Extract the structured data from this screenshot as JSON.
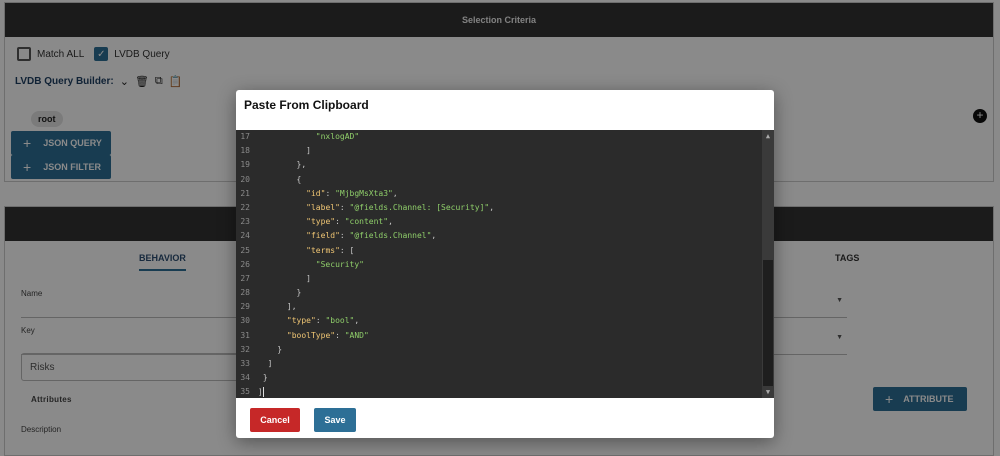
{
  "criteria": {
    "title": "Selection Criteria",
    "match_all_label": "Match ALL",
    "lvdb_query_label": "LVDB Query",
    "query_builder_label": "LVDB Query Builder:",
    "root_label": "root",
    "json_query_button": "JSON QUERY",
    "json_filter_button": "JSON FILTER"
  },
  "behavior": {
    "tabs": {
      "behavior": "BEHAVIOR",
      "tags": "TAGS"
    },
    "name_label": "Name",
    "key_label": "Key",
    "risks_placeholder": "Risks",
    "attributes_label": "Attributes",
    "attribute_button": "ATTRIBUTE",
    "description_label": "Description"
  },
  "modal": {
    "title": "Paste From Clipboard",
    "cancel_label": "Cancel",
    "save_label": "Save",
    "code_lines": [
      {
        "n": "17",
        "parts": [
          {
            "t": "            ",
            "c": ""
          },
          {
            "t": "\"nxlogAD\"",
            "c": "s"
          }
        ]
      },
      {
        "n": "18",
        "parts": [
          {
            "t": "          ]",
            "c": ""
          }
        ]
      },
      {
        "n": "19",
        "parts": [
          {
            "t": "        },",
            "c": ""
          }
        ]
      },
      {
        "n": "20",
        "parts": [
          {
            "t": "        {",
            "c": ""
          }
        ]
      },
      {
        "n": "21",
        "parts": [
          {
            "t": "          ",
            "c": ""
          },
          {
            "t": "\"id\"",
            "c": "k"
          },
          {
            "t": ": ",
            "c": ""
          },
          {
            "t": "\"MjbgMsXta3\"",
            "c": "s"
          },
          {
            "t": ",",
            "c": ""
          }
        ]
      },
      {
        "n": "22",
        "parts": [
          {
            "t": "          ",
            "c": ""
          },
          {
            "t": "\"label\"",
            "c": "k"
          },
          {
            "t": ": ",
            "c": ""
          },
          {
            "t": "\"@fields.Channel: [Security]\"",
            "c": "s"
          },
          {
            "t": ",",
            "c": ""
          }
        ]
      },
      {
        "n": "23",
        "parts": [
          {
            "t": "          ",
            "c": ""
          },
          {
            "t": "\"type\"",
            "c": "k"
          },
          {
            "t": ": ",
            "c": ""
          },
          {
            "t": "\"content\"",
            "c": "s"
          },
          {
            "t": ",",
            "c": ""
          }
        ]
      },
      {
        "n": "24",
        "parts": [
          {
            "t": "          ",
            "c": ""
          },
          {
            "t": "\"field\"",
            "c": "k"
          },
          {
            "t": ": ",
            "c": ""
          },
          {
            "t": "\"@fields.Channel\"",
            "c": "s"
          },
          {
            "t": ",",
            "c": ""
          }
        ]
      },
      {
        "n": "25",
        "parts": [
          {
            "t": "          ",
            "c": ""
          },
          {
            "t": "\"terms\"",
            "c": "k"
          },
          {
            "t": ": [",
            "c": ""
          }
        ]
      },
      {
        "n": "26",
        "parts": [
          {
            "t": "            ",
            "c": ""
          },
          {
            "t": "\"Security\"",
            "c": "s"
          }
        ]
      },
      {
        "n": "27",
        "parts": [
          {
            "t": "          ]",
            "c": ""
          }
        ]
      },
      {
        "n": "28",
        "parts": [
          {
            "t": "        }",
            "c": ""
          }
        ]
      },
      {
        "n": "29",
        "parts": [
          {
            "t": "      ],",
            "c": ""
          }
        ]
      },
      {
        "n": "30",
        "parts": [
          {
            "t": "      ",
            "c": ""
          },
          {
            "t": "\"type\"",
            "c": "k"
          },
          {
            "t": ": ",
            "c": ""
          },
          {
            "t": "\"bool\"",
            "c": "s"
          },
          {
            "t": ",",
            "c": ""
          }
        ]
      },
      {
        "n": "31",
        "parts": [
          {
            "t": "      ",
            "c": ""
          },
          {
            "t": "\"boolType\"",
            "c": "k"
          },
          {
            "t": ": ",
            "c": ""
          },
          {
            "t": "\"AND\"",
            "c": "s"
          }
        ]
      },
      {
        "n": "32",
        "parts": [
          {
            "t": "    }",
            "c": ""
          }
        ]
      },
      {
        "n": "33",
        "parts": [
          {
            "t": "  ]",
            "c": ""
          }
        ]
      },
      {
        "n": "34",
        "parts": [
          {
            "t": " }",
            "c": ""
          }
        ]
      },
      {
        "n": "35",
        "parts": [
          {
            "t": "]",
            "c": ""
          }
        ]
      }
    ]
  },
  "colors": {
    "primary": "#2d6f96",
    "danger": "#c62828",
    "header": "#333333",
    "editor_bg": "#2b2b2b"
  }
}
